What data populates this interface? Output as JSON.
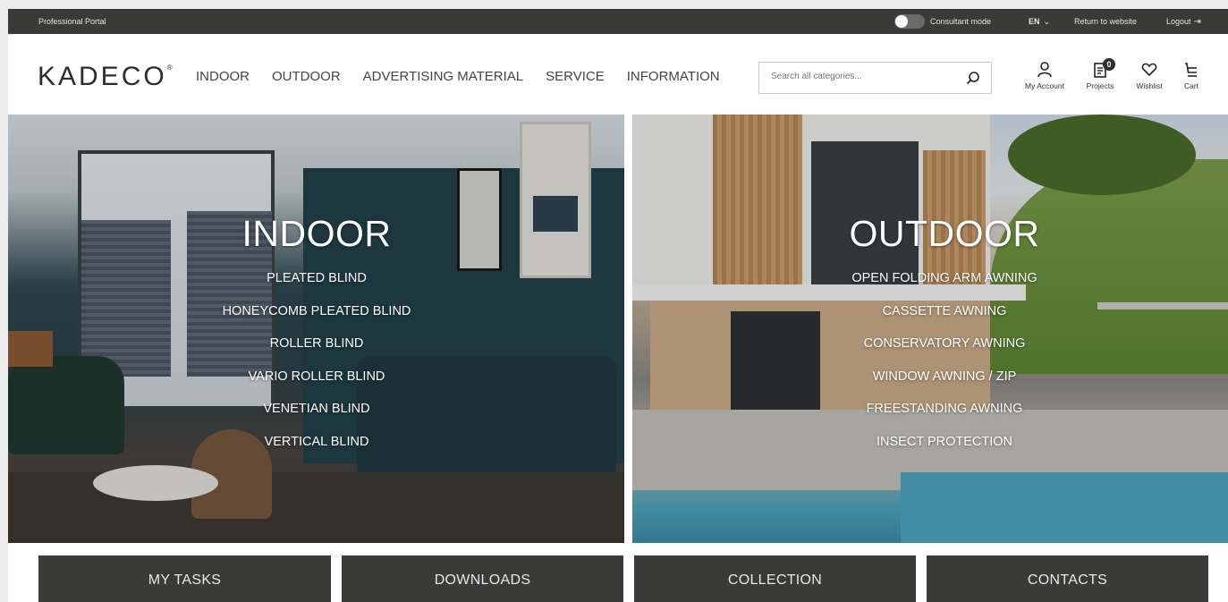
{
  "topbar": {
    "portal_label": "Professional Portal",
    "consultant_mode_label": "Consultant mode",
    "consultant_mode_on": false,
    "language": "EN",
    "return_label": "Return to website",
    "logout_label": "Logout",
    "icons": [
      "chevron-down-icon",
      "logout-icon"
    ]
  },
  "header": {
    "logo": "KADECO",
    "logo_mark": "®",
    "nav": [
      "INDOOR",
      "OUTDOOR",
      "ADVERTISING MATERIAL",
      "SERVICE",
      "INFORMATION"
    ],
    "search": {
      "placeholder": "Search all categories..."
    },
    "icons": {
      "account_label": "My Account",
      "projects_label": "Projects",
      "projects_count": "0",
      "wishlist_label": "Wishlist",
      "cart_label": "Cart"
    }
  },
  "hero": {
    "indoor": {
      "title": "INDOOR",
      "items": [
        "PLEATED BLIND",
        "HONEYCOMB PLEATED BLIND",
        "ROLLER BLIND",
        "VARIO ROLLER BLIND",
        "VENETIAN BLIND",
        "VERTICAL BLIND"
      ]
    },
    "outdoor": {
      "title": "OUTDOOR",
      "items": [
        "OPEN FOLDING ARM AWNING",
        "CASSETTE AWNING",
        "CONSERVATORY AWNING",
        "WINDOW AWNING / ZIP",
        "FREESTANDING AWNING",
        "INSECT PROTECTION"
      ]
    }
  },
  "buttons": [
    "MY TASKS",
    "DOWNLOADS",
    "COLLECTION",
    "CONTACTS"
  ],
  "colors": {
    "dark_bar": "#3a3a38",
    "accent_text": "#ffffff"
  }
}
